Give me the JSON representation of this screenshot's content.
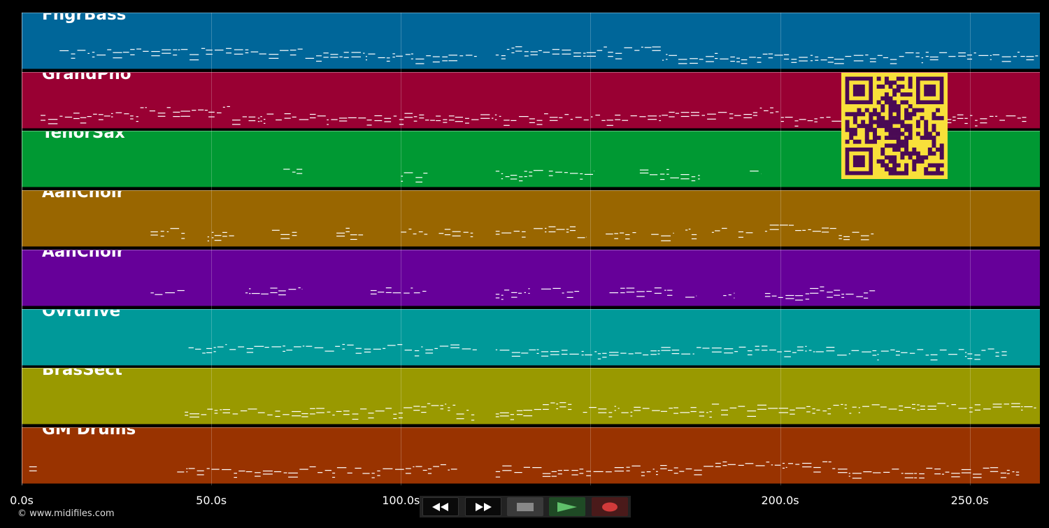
{
  "timeline": {
    "duration": 268.5,
    "ticks": [
      {
        "time": 0,
        "label": "0.0s"
      },
      {
        "time": 50,
        "label": "50.0s"
      },
      {
        "time": 100,
        "label": "100.0s"
      },
      {
        "time": 150,
        "label": "150.0s"
      },
      {
        "time": 200,
        "label": "200.0s"
      },
      {
        "time": 250,
        "label": "250.0s"
      }
    ]
  },
  "tracks": [
    {
      "name": "FngrBass",
      "color": "#006699",
      "segments": [
        [
          10,
          120
        ],
        [
          125,
          268
        ]
      ]
    },
    {
      "name": "GrandPno",
      "color": "#990033",
      "segments": [
        [
          5,
          265
        ]
      ]
    },
    {
      "name": "TenorSax",
      "color": "#009933",
      "segments": [
        [
          69,
          74
        ],
        [
          100,
          107
        ],
        [
          125,
          138
        ],
        [
          139,
          151
        ],
        [
          163,
          179
        ],
        [
          192,
          195
        ]
      ]
    },
    {
      "name": "AahChoir",
      "color": "#996600",
      "segments": [
        [
          34,
          43
        ],
        [
          49,
          56
        ],
        [
          66,
          73
        ],
        [
          83,
          90
        ],
        [
          100,
          107
        ],
        [
          110,
          119
        ],
        [
          125,
          133
        ],
        [
          135,
          149
        ],
        [
          154,
          162
        ],
        [
          166,
          172
        ],
        [
          175,
          178
        ],
        [
          182,
          186
        ],
        [
          189,
          193
        ],
        [
          196,
          225
        ]
      ]
    },
    {
      "name": "AahChoir",
      "color": "#660099",
      "segments": [
        [
          34,
          43
        ],
        [
          59,
          74
        ],
        [
          92,
          107
        ],
        [
          125,
          134
        ],
        [
          137,
          147
        ],
        [
          155,
          172
        ],
        [
          175,
          178
        ],
        [
          185,
          188
        ],
        [
          196,
          225
        ]
      ]
    },
    {
      "name": "Ovrdrive",
      "color": "#009999",
      "segments": [
        [
          44,
          120
        ],
        [
          125,
          182
        ],
        [
          182,
          260
        ]
      ]
    },
    {
      "name": "BrasSect",
      "color": "#999900",
      "segments": [
        [
          43,
          120
        ],
        [
          125,
          145
        ],
        [
          148,
          182
        ],
        [
          182,
          268
        ]
      ]
    },
    {
      "name": "GM Drums",
      "color": "#993300",
      "segments": [
        [
          2,
          4
        ],
        [
          41,
          115
        ],
        [
          125,
          263
        ]
      ]
    }
  ],
  "copyright": "© www.midifiles.com",
  "transport": {
    "rewind_icon": "rewind-icon",
    "forward_icon": "fast-forward-icon",
    "stop_icon": "stop-icon",
    "play_icon": "play-icon",
    "record_icon": "record-icon",
    "colors": {
      "play": "#5fbf6a",
      "record": "#d03a3a",
      "stop": "#888888"
    }
  },
  "qr": {
    "bg": "#f8e03a",
    "fg": "#4a0a55"
  }
}
